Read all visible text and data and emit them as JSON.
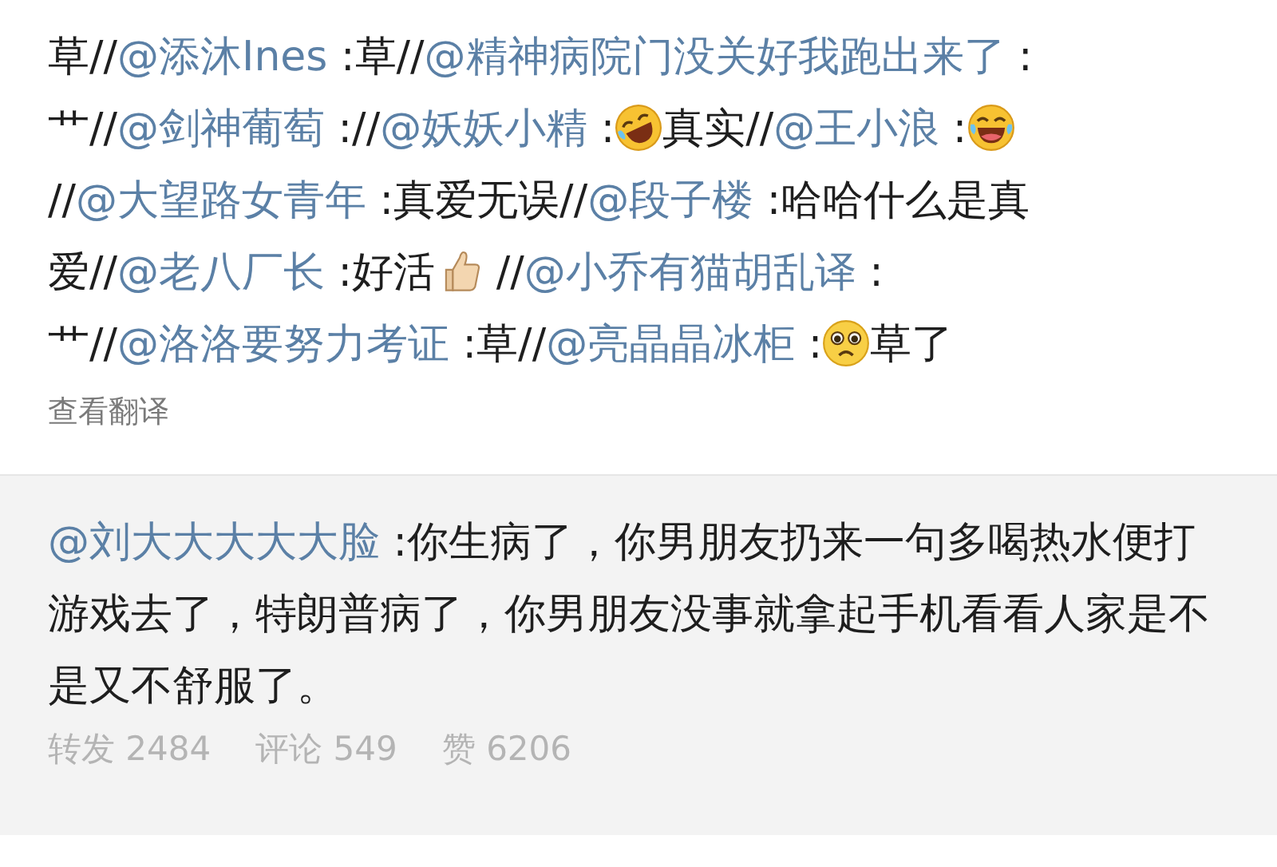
{
  "post": {
    "segments": [
      {
        "kind": "text",
        "text": "草//"
      },
      {
        "kind": "mention",
        "text": "@添沐Ines"
      },
      {
        "kind": "text",
        "text": " :草//"
      },
      {
        "kind": "mention",
        "text": "@精神病院门没关好我跑出来了"
      },
      {
        "kind": "text",
        "text": " :艹//"
      },
      {
        "kind": "mention",
        "text": "@剑神葡萄"
      },
      {
        "kind": "text",
        "text": " ://"
      },
      {
        "kind": "mention",
        "text": "@妖妖小精"
      },
      {
        "kind": "text",
        "text": " :"
      },
      {
        "kind": "tilted_laugh"
      },
      {
        "kind": "text",
        "text": "真实//"
      },
      {
        "kind": "mention",
        "text": "@王小浪"
      },
      {
        "kind": "text",
        "text": " :"
      },
      {
        "kind": "laugh"
      },
      {
        "kind": "text",
        "text": "//"
      },
      {
        "kind": "mention",
        "text": "@大望路女青年"
      },
      {
        "kind": "text",
        "text": " :真爱无误//"
      },
      {
        "kind": "mention",
        "text": "@段子楼"
      },
      {
        "kind": "text",
        "text": " :哈哈什么是真爱//"
      },
      {
        "kind": "mention",
        "text": "@老八厂长"
      },
      {
        "kind": "text",
        "text": " :好活"
      },
      {
        "kind": "thumbs_up"
      },
      {
        "kind": "text",
        "text": " //"
      },
      {
        "kind": "mention",
        "text": "@小乔有猫胡乱译"
      },
      {
        "kind": "text",
        "text": " :艹//"
      },
      {
        "kind": "mention",
        "text": "@洛洛要努力考证"
      },
      {
        "kind": "text",
        "text": " :草//"
      },
      {
        "kind": "mention",
        "text": "@亮晶晶冰柜"
      },
      {
        "kind": "text",
        "text": " :"
      },
      {
        "kind": "pleading"
      },
      {
        "kind": "text",
        "text": "草了"
      }
    ],
    "translate_link": "查看翻译"
  },
  "repost": {
    "segments": [
      {
        "kind": "mention",
        "text": "@刘大大大大大脸"
      },
      {
        "kind": "text",
        "text": " :你生病了，你男朋友扔来一句多喝热水便打游戏去了，特朗普病了，你男朋友没事就拿起手机看看人家是不是又不舒服了。"
      }
    ],
    "actions": [
      {
        "label": "转发 2484"
      },
      {
        "label": "评论 549"
      },
      {
        "label": "赞 6206"
      }
    ]
  }
}
